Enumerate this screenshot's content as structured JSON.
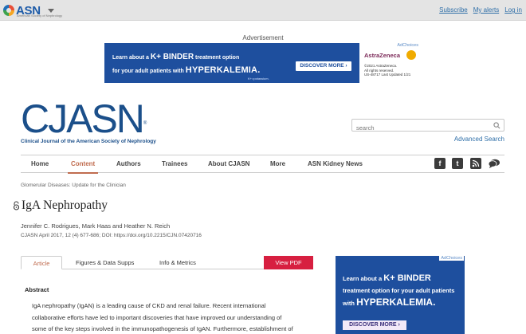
{
  "topbar": {
    "logo_text": "ASN",
    "logo_subtext": "American Society of Nephrology",
    "links": [
      "Subscribe",
      "My alerts",
      "Log in"
    ]
  },
  "ad_top": {
    "label": "Advertisement",
    "line1_pre": "Learn about a",
    "line1_big": "K+ BINDER",
    "line1_post": "treatment option",
    "line2_pre": "for your adult patients with",
    "line2_big": "HYPERKALEMIA.",
    "tag": "K+=potassium.",
    "cta": "DISCOVER MORE ›",
    "brand": "AstraZeneca",
    "fine1": "©2021 AstraZeneca.",
    "fine2": "All rights reserved.",
    "fine3": "US-48717 Last Updated 1/21",
    "choices": "AdChoices"
  },
  "journal": {
    "logo": "CJASN",
    "reg": "®",
    "subtitle": "Clinical Journal of the American Society of Nephrology"
  },
  "search": {
    "placeholder": "search",
    "advanced": "Advanced Search"
  },
  "nav": {
    "items": [
      "Home",
      "Content",
      "Authors",
      "Trainees",
      "About CJASN",
      "More",
      "ASN Kidney News"
    ],
    "active": "Content"
  },
  "article": {
    "breadcrumb": "Glomerular Diseases: Update for the Clinician",
    "title": "IgA Nephropathy",
    "authors": "Jennifer C. Rodrigues, Mark Haas and Heather N. Reich",
    "citation": "CJASN April 2017, 12 (4) 677-686; DOI: https://doi.org/10.2215/CJN.07420716"
  },
  "tabs": {
    "items": [
      "Article",
      "Figures & Data Supps",
      "Info & Metrics"
    ],
    "pdf": "View PDF"
  },
  "abstract": {
    "heading": "Abstract",
    "line1": "IgA nephropathy (IgAN) is a leading cause of CKD and renal failure. Recent international",
    "line2": "collaborative efforts have led to important discoveries that have improved our understanding of",
    "line3": "some of the key steps involved in the immunopathogenesis of IgAN. Furthermore, establishment of"
  },
  "ad_right": {
    "choices": "AdChoices",
    "line1_pre": "Learn about a",
    "line1_big": "K+ BINDER",
    "line2": "treatment option for your adult patients",
    "line3_pre": "with",
    "line3_big": "HYPERKALEMIA.",
    "cta": "DISCOVER MORE ›"
  },
  "colors": {
    "brand_blue": "#1b4f8a",
    "accent": "#c06c4f",
    "pdf_red": "#d71f40",
    "ad_blue": "#1e4f9e"
  }
}
